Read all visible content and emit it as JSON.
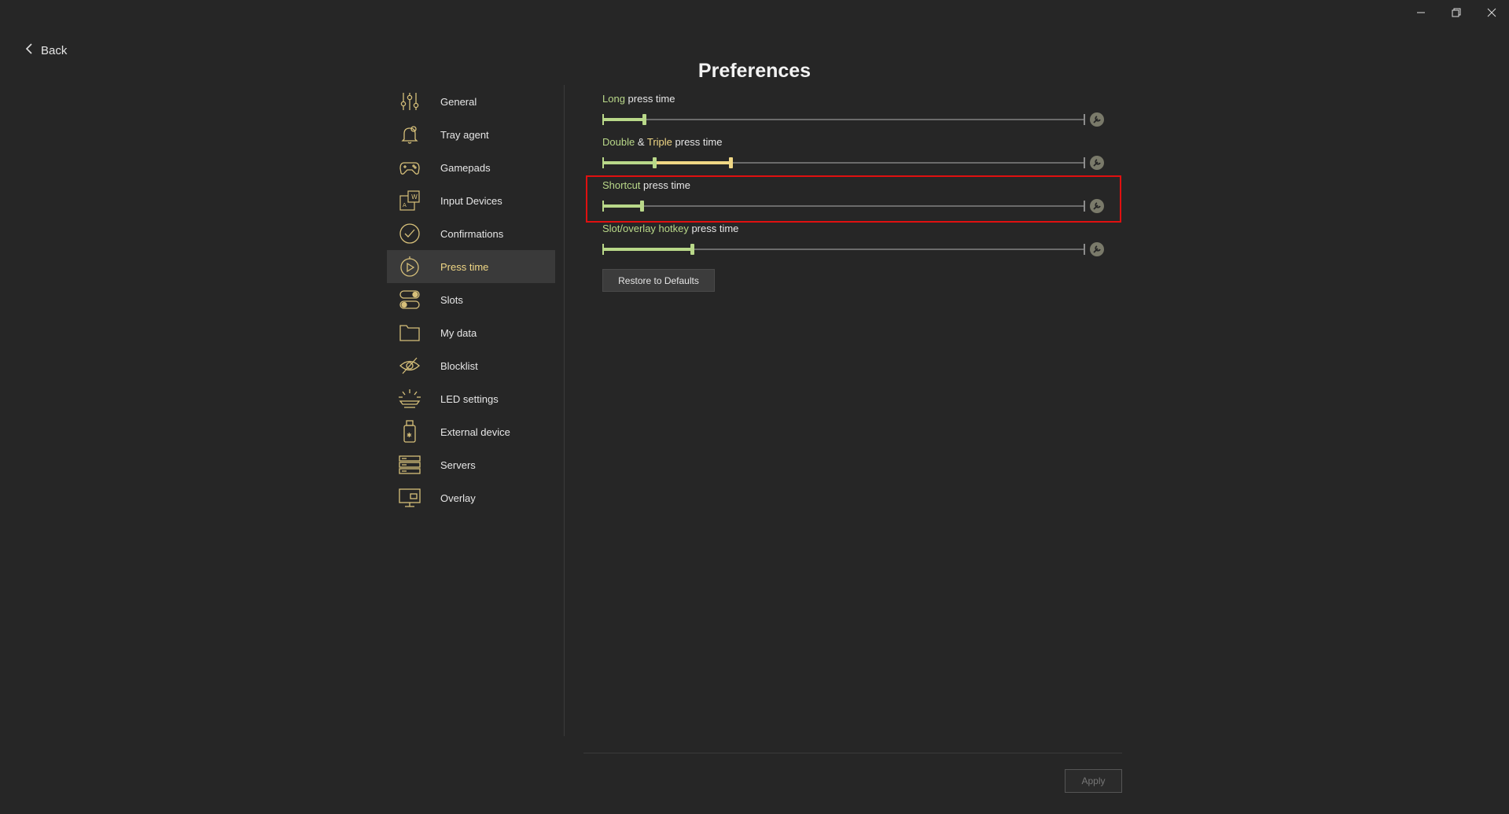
{
  "window": {
    "minimize_icon": "minimize-icon",
    "restore_icon": "restore-icon",
    "close_icon": "close-icon"
  },
  "back": {
    "label": "Back"
  },
  "page": {
    "title": "Preferences"
  },
  "sidebar": {
    "items": [
      {
        "label": "General",
        "icon": "sliders-icon"
      },
      {
        "label": "Tray agent",
        "icon": "bell-icon"
      },
      {
        "label": "Gamepads",
        "icon": "gamepad-icon"
      },
      {
        "label": "Input Devices",
        "icon": "keyboard-icon"
      },
      {
        "label": "Confirmations",
        "icon": "check-circle-icon"
      },
      {
        "label": "Press time",
        "icon": "timer-icon",
        "active": true
      },
      {
        "label": "Slots",
        "icon": "toggle-icon"
      },
      {
        "label": "My data",
        "icon": "folder-icon"
      },
      {
        "label": "Blocklist",
        "icon": "eye-slash-icon"
      },
      {
        "label": "LED settings",
        "icon": "led-icon"
      },
      {
        "label": "External device",
        "icon": "usb-device-icon"
      },
      {
        "label": "Servers",
        "icon": "server-icon"
      },
      {
        "label": "Overlay",
        "icon": "monitor-icon"
      }
    ]
  },
  "settings": {
    "long": {
      "accent": "Long",
      "rest": " press time",
      "value_fraction": 0.086
    },
    "double_triple": {
      "accent1": "Double",
      "mid": " & ",
      "accent2": "Triple",
      "rest": " press time",
      "value1_fraction": 0.108,
      "value2_fraction": 0.265
    },
    "shortcut": {
      "accent": "Shortcut",
      "rest": " press time",
      "value_fraction": 0.082
    },
    "slot_overlay": {
      "accent": "Slot/overlay hotkey",
      "rest": " press time",
      "value_fraction": 0.186
    }
  },
  "colors": {
    "accent_green": "#b9d889",
    "accent_yellow": "#f0d785",
    "highlight": "#e01010"
  },
  "actions": {
    "restore_label": "Restore to Defaults",
    "apply_label": "Apply"
  }
}
